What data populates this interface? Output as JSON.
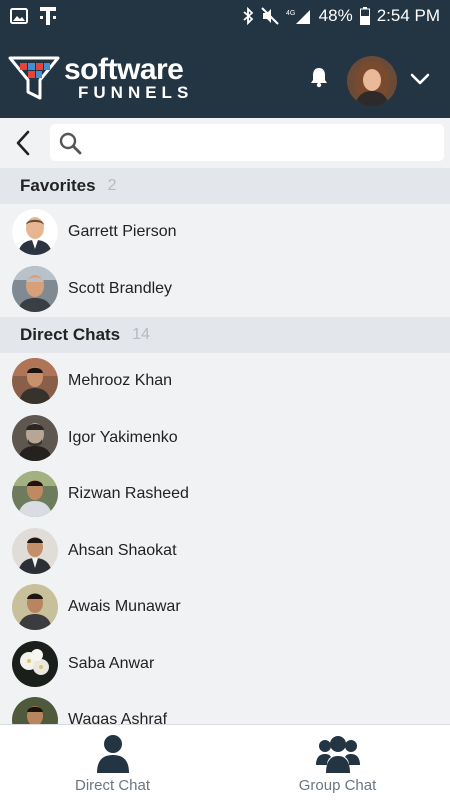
{
  "status_bar": {
    "battery": "48%",
    "time": "2:54 PM"
  },
  "app": {
    "logo_word1": "software",
    "logo_word2": "FUNNELS"
  },
  "search": {
    "placeholder": ""
  },
  "favorites": {
    "title": "Favorites",
    "count": "2",
    "items": [
      {
        "name": "Garrett Pierson"
      },
      {
        "name": "Scott Brandley"
      }
    ]
  },
  "direct_chats": {
    "title": "Direct Chats",
    "count": "14",
    "items": [
      {
        "name": "Mehrooz Khan"
      },
      {
        "name": "Igor Yakimenko"
      },
      {
        "name": "Rizwan Rasheed"
      },
      {
        "name": "Ahsan Shaokat"
      },
      {
        "name": "Awais Munawar"
      },
      {
        "name": "Saba Anwar"
      },
      {
        "name": "Waqas Ashraf"
      }
    ]
  },
  "tabs": {
    "direct_chat": "Direct Chat",
    "group_chat": "Group Chat"
  },
  "colors": {
    "header": "#233443",
    "list_bg": "#f1f2f4",
    "section_bg": "#e3e6ea",
    "tab_icon": "#233443"
  },
  "icons": [
    "photo-icon",
    "t-carrier-icon",
    "bluetooth-icon",
    "mute-icon",
    "signal-icon",
    "battery-icon",
    "bell-icon",
    "chevron-down-icon",
    "back-arrow-icon",
    "search-icon",
    "person-icon",
    "group-icon"
  ]
}
